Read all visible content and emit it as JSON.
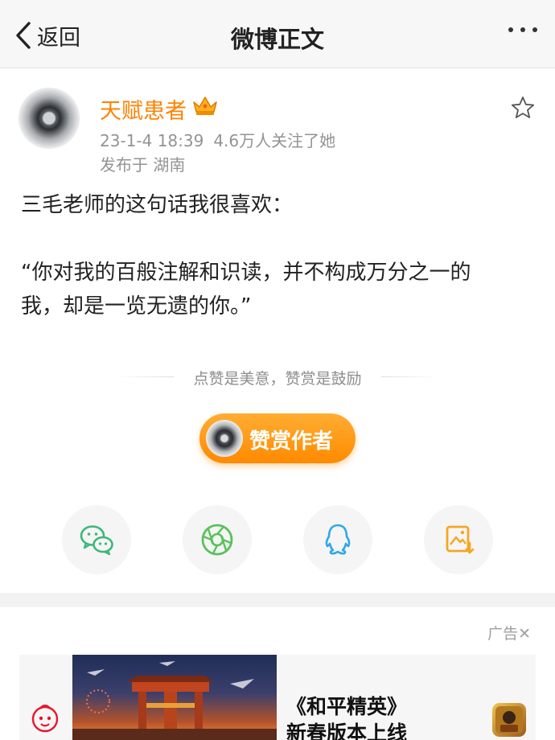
{
  "nav": {
    "back_label": "返回",
    "title": "微博正文",
    "more_icon": "more-dots-icon"
  },
  "author": {
    "name": "天赋患者",
    "badge_icon": "crown-icon",
    "time": "23-1-4 18:39",
    "followers": "4.6万人关注了她",
    "location": "发布于 湖南"
  },
  "post": {
    "lines": [
      "三毛老师的这句话我很喜欢：",
      "“你对我的百般注解和识读，并不构成万分之一的",
      "我，却是一览无遗的你。”"
    ]
  },
  "reward": {
    "note": "点赞是美意，赞赏是鼓励",
    "button_label": "赞赏作者"
  },
  "share": {
    "items": [
      {
        "icon": "wechat-icon",
        "color": "#3cb878"
      },
      {
        "icon": "moments-icon",
        "color": "#58c25a"
      },
      {
        "icon": "qq-icon",
        "color": "#2fa8e8"
      },
      {
        "icon": "save-image-icon",
        "color": "#f5a623"
      }
    ]
  },
  "ad": {
    "label": "广告✕",
    "title_line1": "《和平精英》",
    "title_line2": "新春版本上线"
  },
  "colors": {
    "accent": "#ff8200",
    "reward_button": "#ff9500"
  }
}
